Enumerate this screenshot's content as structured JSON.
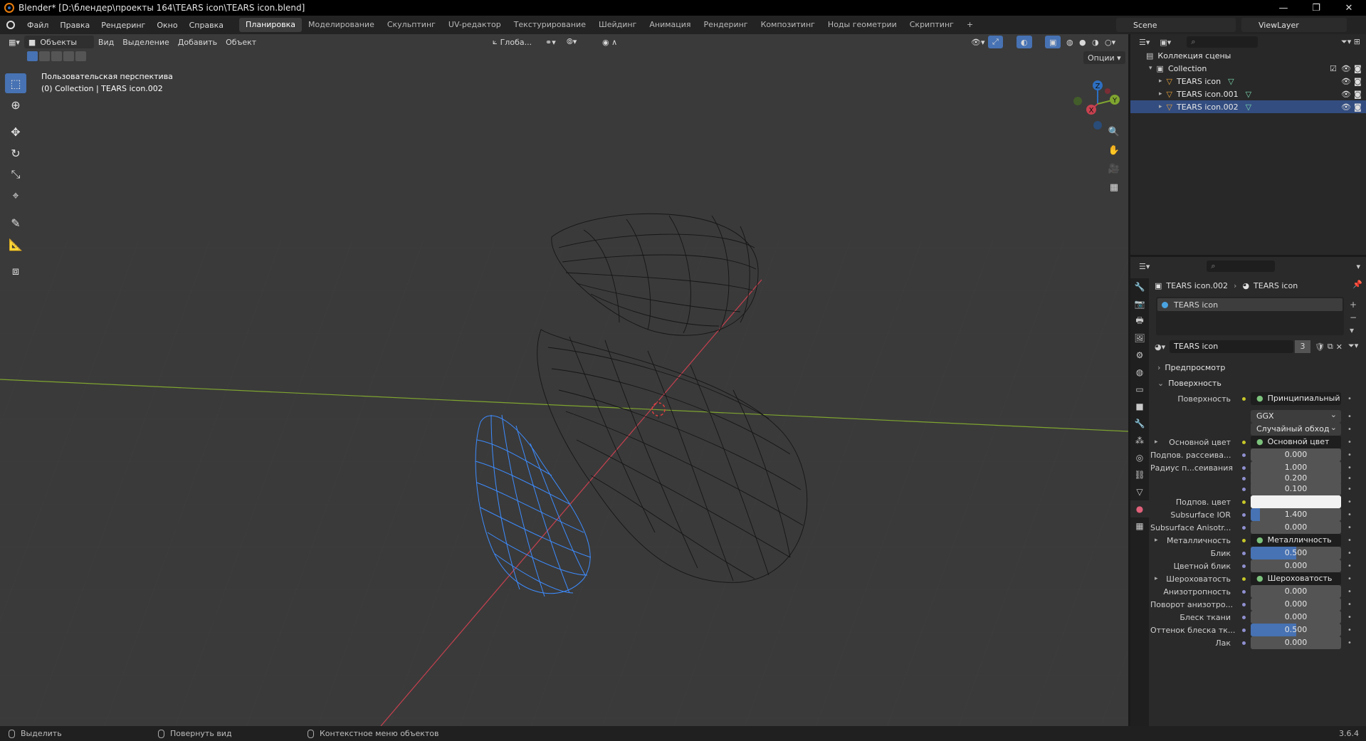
{
  "window": {
    "title": "Blender* [D:\\блендер\\проекты 164\\TEARS icon\\TEARS icon.blend]",
    "controls": [
      "—",
      "❐",
      "✕"
    ]
  },
  "menu": [
    "Файл",
    "Правка",
    "Рендеринг",
    "Окно",
    "Справка"
  ],
  "workspaces": [
    "Планировка",
    "Моделирование",
    "Скульптинг",
    "UV-редактор",
    "Текстурирование",
    "Шейдинг",
    "Анимация",
    "Рендеринг",
    "Композитинг",
    "Ноды геометрии",
    "Скриптинг"
  ],
  "workspace_add": "+",
  "scene": "Scene",
  "view_layer": "ViewLayer",
  "viewport": {
    "mode": "Объекты",
    "menus": [
      "Вид",
      "Выделение",
      "Добавить",
      "Объект"
    ],
    "transform_orientation": "Глоба...",
    "options": "Опции",
    "perspective_label": "Пользовательская перспектива",
    "collection_label": "(0) Collection | TEARS icon.002",
    "gizmo": {
      "x": "X",
      "y": "Y",
      "z": "Z"
    }
  },
  "outliner": {
    "root": "Коллекция сцены",
    "collection": "Collection",
    "items": [
      {
        "name": "TEARS icon",
        "selected": false
      },
      {
        "name": "TEARS icon.001",
        "selected": false
      },
      {
        "name": "TEARS icon.002",
        "selected": true
      }
    ]
  },
  "properties": {
    "breadcrumb_object": "TEARS icon.002",
    "breadcrumb_material": "TEARS icon",
    "material_slot": "TEARS icon",
    "material_name": "TEARS icon",
    "material_users": "3",
    "section_preview": "Предпросмотр",
    "section_surface": "Поверхность",
    "rows": [
      {
        "label": "Поверхность",
        "value": "Принципиальный BSDF",
        "kind": "link"
      },
      {
        "label": "",
        "value": "GGX",
        "kind": "dropdown"
      },
      {
        "label": "",
        "value": "Случайный обход",
        "kind": "dropdown"
      },
      {
        "label": "Основной цвет",
        "value": "Основной цвет",
        "kind": "link",
        "expand": true
      },
      {
        "label": "Подпов. рассеива...",
        "value": "0.000",
        "kind": "number",
        "fill": 0
      },
      {
        "label": "Радиус п...сеивания",
        "value": "1.000",
        "kind": "number",
        "fill": 0
      },
      {
        "label": "",
        "value": "0.200",
        "kind": "number",
        "fill": 0
      },
      {
        "label": "",
        "value": "0.100",
        "kind": "number",
        "fill": 0
      },
      {
        "label": "Подпов. цвет",
        "value": "",
        "kind": "color",
        "color": "#f2f2f2"
      },
      {
        "label": "Subsurface IOR",
        "value": "1.400",
        "kind": "number",
        "fill": 0.1
      },
      {
        "label": "Subsurface Anisotr...",
        "value": "0.000",
        "kind": "number",
        "fill": 0
      },
      {
        "label": "Металличность",
        "value": "Металличность",
        "kind": "link",
        "expand": true
      },
      {
        "label": "Блик",
        "value": "0.500",
        "kind": "number",
        "fill": 0.5
      },
      {
        "label": "Цветной блик",
        "value": "0.000",
        "kind": "number",
        "fill": 0
      },
      {
        "label": "Шероховатость",
        "value": "Шероховатость",
        "kind": "link",
        "expand": true
      },
      {
        "label": "Анизотропность",
        "value": "0.000",
        "kind": "number",
        "fill": 0
      },
      {
        "label": "Поворот анизотро...",
        "value": "0.000",
        "kind": "number",
        "fill": 0
      },
      {
        "label": "Блеск ткани",
        "value": "0.000",
        "kind": "number",
        "fill": 0
      },
      {
        "label": "Оттенок блеска тк...",
        "value": "0.500",
        "kind": "number",
        "fill": 0.5
      },
      {
        "label": "Лак",
        "value": "0.000",
        "kind": "number",
        "fill": 0
      }
    ]
  },
  "statusbar": {
    "select": "Выделить",
    "rotate": "Повернуть вид",
    "context": "Контекстное меню объектов",
    "version": "3.6.4"
  },
  "colors": {
    "accent": "#4772b3",
    "selection": "#334d80",
    "wire": "#111111",
    "wire_selected": "#3d8cff",
    "axis_x": "#c8414f",
    "axis_y": "#7fa52f"
  }
}
